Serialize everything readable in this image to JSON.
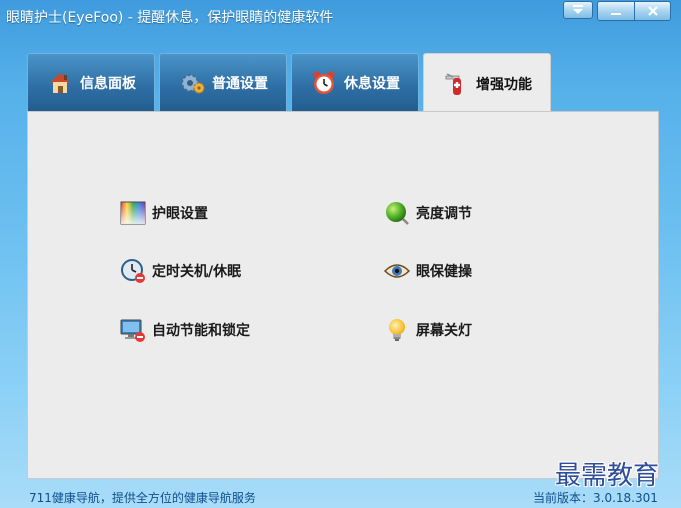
{
  "window": {
    "title": "眼睛护士(EyeFoo) - 提醒休息，保护眼睛的健康软件",
    "controls": {
      "menu": "menu-dropdown-icon",
      "minimize": "minimize-icon",
      "close": "close-icon"
    }
  },
  "tabs": [
    {
      "label": "信息面板",
      "icon": "home-icon",
      "active": false
    },
    {
      "label": "普通设置",
      "icon": "gear-icon",
      "active": false
    },
    {
      "label": "休息设置",
      "icon": "alarm-clock-icon",
      "active": false
    },
    {
      "label": "增强功能",
      "icon": "swiss-knife-icon",
      "active": true
    }
  ],
  "features": {
    "left": [
      {
        "label": "护眼设置",
        "icon": "color-palette-icon"
      },
      {
        "label": "定时关机/休眠",
        "icon": "timer-shutdown-icon"
      },
      {
        "label": "自动节能和锁定",
        "icon": "monitor-lock-icon"
      }
    ],
    "right": [
      {
        "label": "亮度调节",
        "icon": "brightness-orb-icon"
      },
      {
        "label": "眼保健操",
        "icon": "eye-icon"
      },
      {
        "label": "屏幕关灯",
        "icon": "light-bulb-icon"
      }
    ]
  },
  "footer": {
    "nav_link": "711健康导航，提供全方位的健康导航服务",
    "version": "当前版本：3.0.18.301"
  },
  "watermark": "最需教育",
  "colors": {
    "tab_inactive": "#2f6fa5",
    "tab_active": "#ececec",
    "panel_bg": "#ececec",
    "footer_text": "#0d4f8f"
  }
}
